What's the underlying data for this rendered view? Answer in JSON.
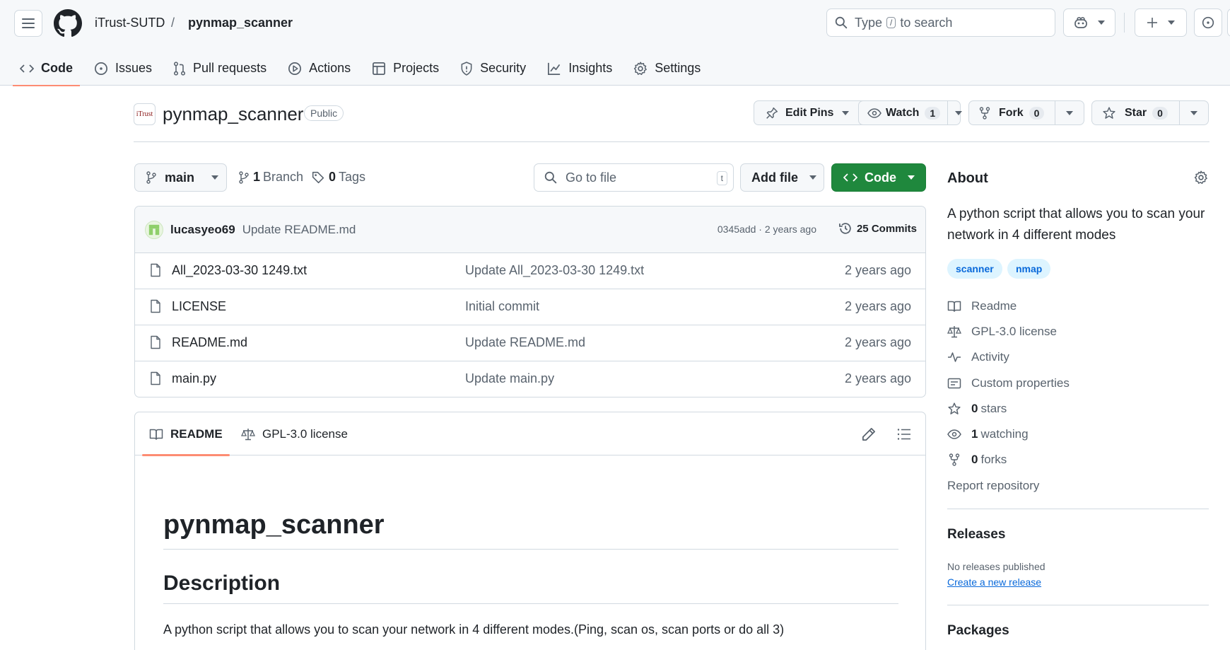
{
  "header": {
    "owner": "iTrust-SUTD",
    "separator": "/",
    "repo": "pynmap_scanner",
    "search_prefix": "Type",
    "search_key": "/",
    "search_suffix": "to search"
  },
  "nav": {
    "tabs": [
      {
        "label": "Code",
        "icon": "code-icon"
      },
      {
        "label": "Issues",
        "icon": "issue-icon"
      },
      {
        "label": "Pull requests",
        "icon": "pull-request-icon"
      },
      {
        "label": "Actions",
        "icon": "play-icon"
      },
      {
        "label": "Projects",
        "icon": "table-icon"
      },
      {
        "label": "Security",
        "icon": "shield-icon"
      },
      {
        "label": "Insights",
        "icon": "graph-icon"
      },
      {
        "label": "Settings",
        "icon": "gear-icon"
      }
    ]
  },
  "repo": {
    "avatar_text": "iTrust",
    "name": "pynmap_scanner",
    "visibility": "Public",
    "edit_pins": "Edit Pins",
    "watch": "Watch",
    "watch_count": "1",
    "fork": "Fork",
    "fork_count": "0",
    "star": "Star",
    "star_count": "0"
  },
  "branch": {
    "name": "main",
    "branch_count": "1",
    "branch_label": "Branch",
    "tag_count": "0",
    "tag_label": "Tags",
    "goto_placeholder": "Go to file",
    "goto_key": "t",
    "add_file": "Add file",
    "code": "Code"
  },
  "commit": {
    "user": "lucasyeo69",
    "message": "Update README.md",
    "meta": "0345add · 2 years ago",
    "commits": "25 Commits"
  },
  "files": [
    {
      "name": "All_2023-03-30 1249.txt",
      "message": "Update All_2023-03-30 1249.txt",
      "age": "2 years ago"
    },
    {
      "name": "LICENSE",
      "message": "Initial commit",
      "age": "2 years ago"
    },
    {
      "name": "README.md",
      "message": "Update README.md",
      "age": "2 years ago"
    },
    {
      "name": "main.py",
      "message": "Update main.py",
      "age": "2 years ago"
    }
  ],
  "readme": {
    "tab_readme": "README",
    "tab_license": "GPL-3.0 license",
    "h1": "pynmap_scanner",
    "h2": "Description",
    "paragraph": "A python script that allows you to scan your network in 4 different modes.(Ping, scan os, scan ports or do all 3)"
  },
  "about": {
    "heading": "About",
    "description": "A python script that allows you to scan your network in 4 different modes",
    "topics": [
      "scanner",
      "nmap"
    ],
    "readme": "Readme",
    "license": "GPL-3.0 license",
    "activity": "Activity",
    "custom_properties": "Custom properties",
    "stars_count": "0",
    "stars_label": "stars",
    "watching_count": "1",
    "watching_label": "watching",
    "forks_count": "0",
    "forks_label": "forks",
    "report": "Report repository"
  },
  "releases": {
    "heading": "Releases",
    "none": "No releases published",
    "create": "Create a new release"
  },
  "packages": {
    "heading": "Packages"
  },
  "colors": {
    "accent_green": "#1f883d",
    "tab_underline": "#fd8c73",
    "link_blue": "#0969da"
  }
}
